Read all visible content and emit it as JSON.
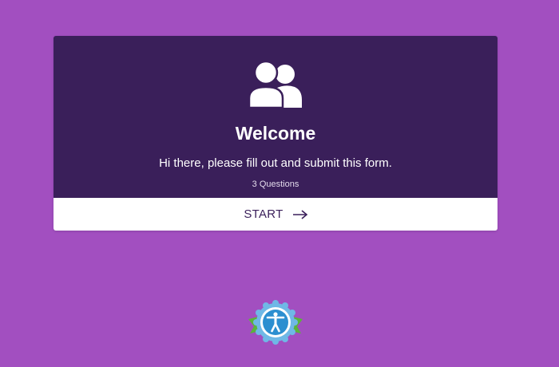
{
  "welcome": {
    "icon": "users-icon",
    "title": "Welcome",
    "message": "Hi there, please fill out and submit this form.",
    "question_count": "3 Questions"
  },
  "start_button": {
    "label": "START",
    "icon": "arrow-right-icon"
  },
  "accessibility_badge": {
    "icon": "accessibility-icon"
  },
  "colors": {
    "page_background": "#a24fc0",
    "card_header": "#3a1f5a",
    "button_background": "#ffffff",
    "badge_blue": "#2c8fd0",
    "badge_green": "#5ab33c"
  }
}
